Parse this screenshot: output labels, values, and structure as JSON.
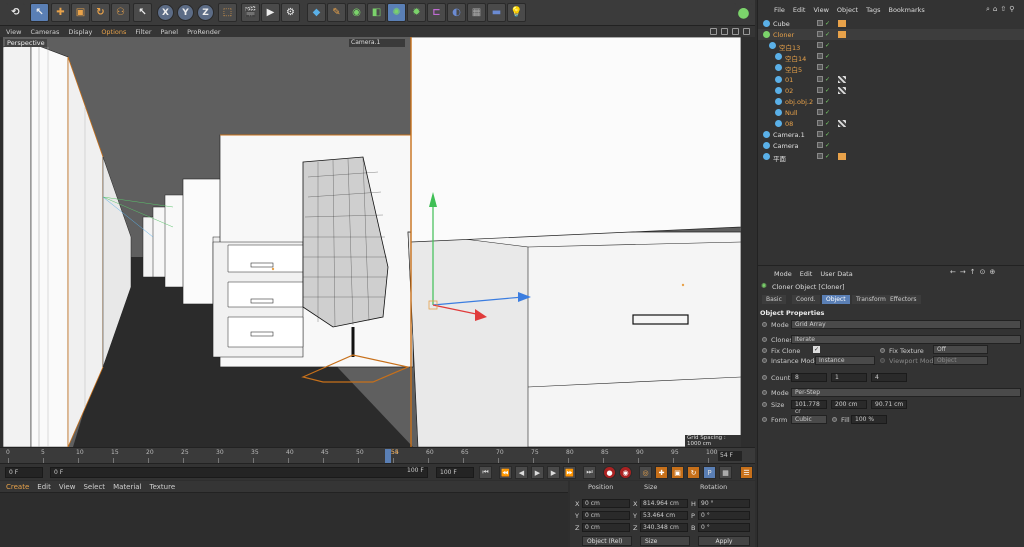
{
  "viewport_menu": [
    "View",
    "Cameras",
    "Display",
    "Options",
    "Filter",
    "Panel",
    "ProRender"
  ],
  "viewport": {
    "label": "Perspective",
    "camera": "Camera.1",
    "grid_info": "Grid Spacing : 1000 cm"
  },
  "timeline": {
    "ticks": [
      "0",
      "5",
      "10",
      "15",
      "20",
      "25",
      "30",
      "35",
      "40",
      "45",
      "50",
      "55",
      "60",
      "65",
      "70",
      "75",
      "80",
      "85",
      "90",
      "95",
      "100"
    ],
    "current_marker": "54",
    "frame_current": "54 F",
    "start": "0 F",
    "start2": "0 F",
    "end": "100 F",
    "end2": "100 F"
  },
  "material_menu": [
    "Create",
    "Edit",
    "View",
    "Select",
    "Material",
    "Texture"
  ],
  "coords": {
    "headers": [
      "Position",
      "Size",
      "Rotation"
    ],
    "rows": [
      {
        "axis": "X",
        "pos": "0 cm",
        "size_axis": "X",
        "size": "814.964 cm",
        "rot_axis": "H",
        "rot": "90 °"
      },
      {
        "axis": "Y",
        "pos": "0 cm",
        "size_axis": "Y",
        "size": "53.464 cm",
        "rot_axis": "P",
        "rot": "0 °"
      },
      {
        "axis": "Z",
        "pos": "0 cm",
        "size_axis": "Z",
        "size": "340.348 cm",
        "rot_axis": "B",
        "rot": "0 °"
      }
    ],
    "mode": "Object (Rel)",
    "size_mode": "Size",
    "apply": "Apply"
  },
  "object_menu": [
    "File",
    "Edit",
    "View",
    "Object",
    "Tags",
    "Bookmarks"
  ],
  "objects": [
    {
      "name": "Cube",
      "color": "#e0e0e0",
      "indent": 0
    },
    {
      "name": "Cloner",
      "color": "#e8a24a",
      "indent": 0
    },
    {
      "name": "空白13",
      "color": "#e8a24a",
      "indent": 1
    },
    {
      "name": "空白14",
      "color": "#e8a24a",
      "indent": 2
    },
    {
      "name": "空白5",
      "color": "#e8a24a",
      "indent": 2
    },
    {
      "name": "01",
      "color": "#e8a24a",
      "indent": 2
    },
    {
      "name": "02",
      "color": "#e8a24a",
      "indent": 2
    },
    {
      "name": "obj.obj.2",
      "color": "#e8a24a",
      "indent": 2
    },
    {
      "name": "Null",
      "color": "#e8a24a",
      "indent": 2
    },
    {
      "name": "08",
      "color": "#e8a24a",
      "indent": 2
    },
    {
      "name": "Camera.1",
      "color": "#e0e0e0",
      "indent": 0
    },
    {
      "name": "Camera",
      "color": "#e0e0e0",
      "indent": 0
    },
    {
      "name": "平面",
      "color": "#e0e0e0",
      "indent": 0
    }
  ],
  "attr_menu": [
    "Mode",
    "Edit",
    "User Data"
  ],
  "attr": {
    "title": "Cloner Object [Cloner]",
    "tabs": [
      "Basic",
      "Coord.",
      "Object",
      "Transform",
      "Effectors"
    ],
    "section": "Object Properties",
    "mode_label": "Mode",
    "mode_value": "Grid Array",
    "clones_label": "Clones",
    "clones_value": "Iterate",
    "fix_clone_label": "Fix Clone",
    "fix_texture_label": "Fix Texture",
    "fix_texture_value": "Off",
    "instance_mode_label": "Instance Mode",
    "instance_mode_value": "Instance",
    "viewport_mode_label": "Viewport Mode",
    "viewport_mode_value": "Object",
    "count_label": "Count",
    "count": [
      "8",
      "1",
      "4"
    ],
    "mode2_label": "Mode",
    "mode2_value": "Per-Step",
    "size_label": "Size",
    "size": [
      "101.778 cr",
      "200 cm",
      "90.71 cm"
    ],
    "form_label": "Form",
    "form_value": "Cubic",
    "fill_label": "Fill",
    "fill_value": "100 %"
  }
}
